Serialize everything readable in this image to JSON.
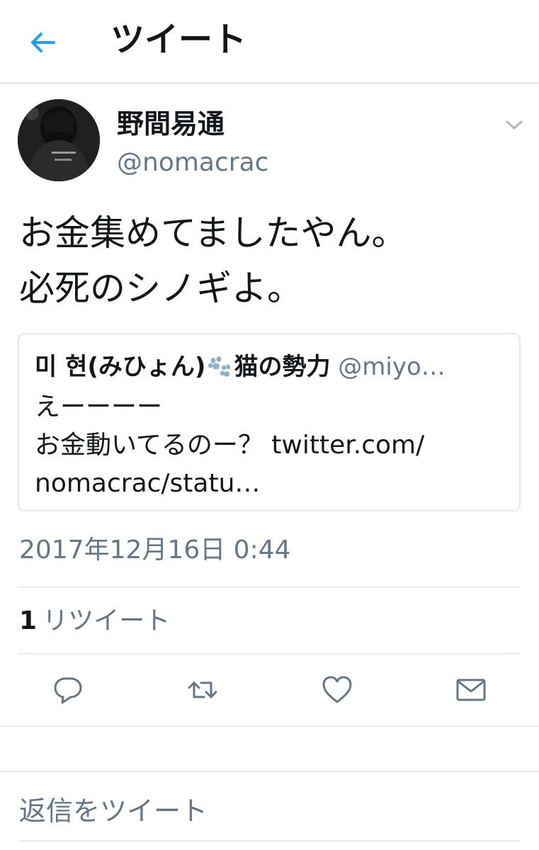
{
  "header": {
    "title": "ツイート",
    "back_icon": "arrow-left-icon",
    "accent_color": "#1da1f2"
  },
  "tweet": {
    "display_name": "野間易通",
    "screen_name": "@nomacrac",
    "text_lines": [
      "お金集めてましたやん。",
      "必死のシノギよ。"
    ],
    "timestamp": "2017年12月16日 0:44"
  },
  "quote": {
    "name_part1": "미 현(みひょん)",
    "name_icon": "paw-icon",
    "name_part2": "猫の勢力",
    "handle": "@miyo…",
    "body_lines": [
      "えーーーー",
      "お金動いてるのー？ twitter.com/",
      "nomacrac/statu…"
    ]
  },
  "stats": {
    "retweet_count": "1",
    "retweet_label": "リツイート"
  },
  "actions": {
    "reply_icon": "reply-icon",
    "retweet_icon": "retweet-icon",
    "like_icon": "heart-icon",
    "dm_icon": "envelope-icon",
    "icon_color": "#657786"
  },
  "reply": {
    "placeholder": "返信をツイート"
  }
}
